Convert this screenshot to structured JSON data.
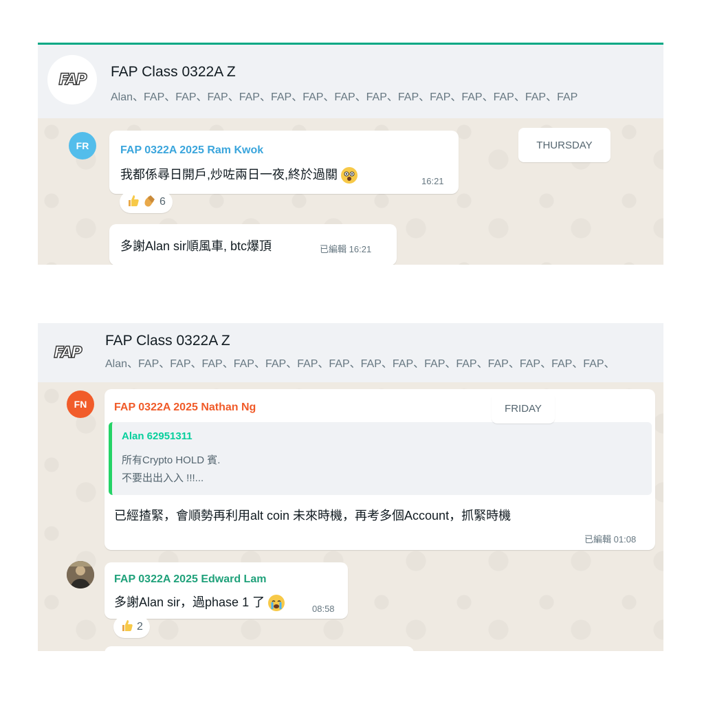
{
  "panel1": {
    "group": {
      "title": "FAP Class 0322A Z",
      "members": "Alan、FAP、FAP、FAP、FAP、FAP、FAP、FAP、FAP、FAP、FAP、FAP、FAP、FAP、FAP",
      "logo": "FAP"
    },
    "day_label": "THURSDAY",
    "message1": {
      "avatar_initials": "FR",
      "avatar_color": "#53bdeb",
      "sender": "FAP 0322A 2025 Ram Kwok",
      "sender_color": "#3aa5dc",
      "text": "我都係尋日開戶,炒咗兩日一夜,終於過關",
      "time": "16:21"
    },
    "reaction1": {
      "count": "6",
      "icons": [
        "thumbs-up-icon",
        "clapping-hands-icon"
      ]
    },
    "message2": {
      "text": "多謝Alan sir順風車, btc爆頂",
      "edited": "已編輯",
      "time": "16:21"
    }
  },
  "panel2": {
    "group": {
      "title": "FAP Class 0322A Z",
      "members": "Alan、FAP、FAP、FAP、FAP、FAP、FAP、FAP、FAP、FAP、FAP、FAP、FAP、FAP、FAP、FAP、",
      "logo": "FAP"
    },
    "day_label": "FRIDAY",
    "message1": {
      "avatar_initials": "FN",
      "avatar_color": "#f15c2a",
      "sender": "FAP 0322A 2025 Nathan Ng",
      "sender_color": "#f05a28",
      "quote_author": "Alan 62951311",
      "quote_author_color": "#06cf9c",
      "quote_line1": "所有Crypto HOLD 賓.",
      "quote_line2": "不要出出入入 !!!...",
      "text": "已經揸緊，會順勢再利用alt coin 未來時機，再考多個Account，抓緊時機",
      "edited": "已編輯",
      "time": "01:08"
    },
    "message2": {
      "sender": "FAP 0322A 2025 Edward Lam",
      "sender_color": "#1fa17a",
      "text": "多謝Alan sir，過phase 1 了",
      "time": "08:58"
    },
    "reaction2": {
      "count": "2",
      "icons": [
        "thumbs-up-icon"
      ]
    }
  }
}
